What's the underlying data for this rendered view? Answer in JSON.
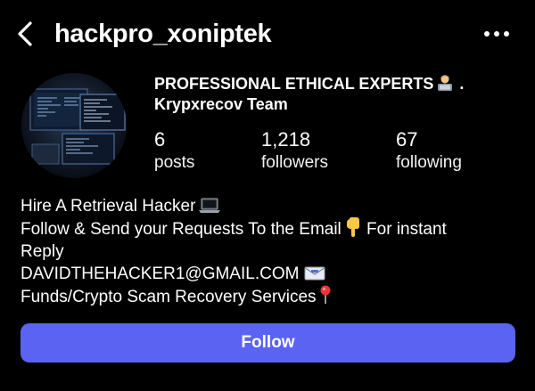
{
  "header": {
    "username": "hackpro_xoniptek",
    "back_icon": "chevron-left-icon",
    "more_icon": "more-horizontal-icon"
  },
  "profile": {
    "avatar_icon": "computer-screens-avatar",
    "display_name": "PROFESSIONAL ETHICAL EXPERTS",
    "display_name_suffix": " .",
    "display_name_emoji": "technologist-emoji",
    "subtitle": "Krypxrecov Team"
  },
  "stats": {
    "posts": {
      "value": "6",
      "label": "posts"
    },
    "followers": {
      "value": "1,218",
      "label": "followers"
    },
    "following": {
      "value": "67",
      "label": "following"
    }
  },
  "bio": {
    "line1": "Hire A Retrieval Hacker",
    "line1_emoji": "laptop-emoji",
    "line2": "Follow & Send your Requests To the Email",
    "line2_emoji": "pointing-down-emoji",
    "line2_tail": " For instant",
    "line3": "Reply",
    "line4": "DAVIDTHEHACKER1@GMAIL.COM",
    "line4_emoji": "envelope-emoji",
    "line5": "Funds/Crypto Scam Recovery Services",
    "line5_emoji": "round-pushpin-emoji"
  },
  "actions": {
    "follow_label": "Follow"
  },
  "colors": {
    "background": "#000000",
    "text": "#ffffff",
    "follow_button": "#5b63f3"
  }
}
